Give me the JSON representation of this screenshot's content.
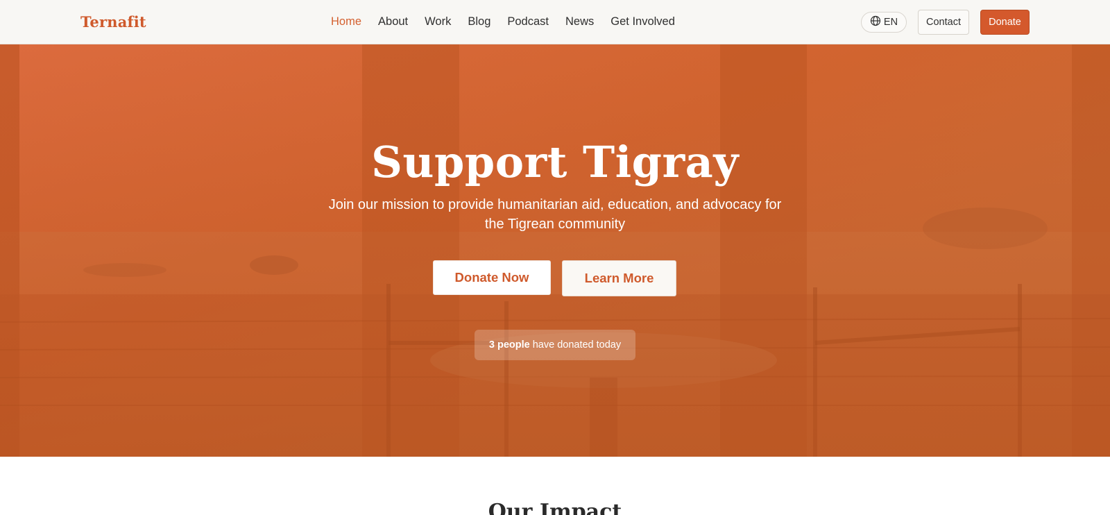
{
  "brand": {
    "logo": "Ternafit",
    "accent_color": "#d4592c"
  },
  "nav": {
    "items": [
      {
        "label": "Home",
        "active": true
      },
      {
        "label": "About"
      },
      {
        "label": "Work"
      },
      {
        "label": "Blog"
      },
      {
        "label": "Podcast"
      },
      {
        "label": "News"
      },
      {
        "label": "Get Involved"
      }
    ]
  },
  "header_actions": {
    "language": "EN",
    "language_icon": "globe-icon",
    "contact_label": "Contact",
    "donate_label": "Donate"
  },
  "hero": {
    "title": "Support Tigray",
    "subtitle": "Join our mission to provide humanitarian aid, education, and advocacy for the Tigrean community",
    "primary_cta": "Donate Now",
    "secondary_cta": "Learn More",
    "donor_count": "3 people",
    "donor_text": "have donated today",
    "overlay_color": "#d4602f"
  },
  "impact": {
    "title": "Our Impact"
  }
}
